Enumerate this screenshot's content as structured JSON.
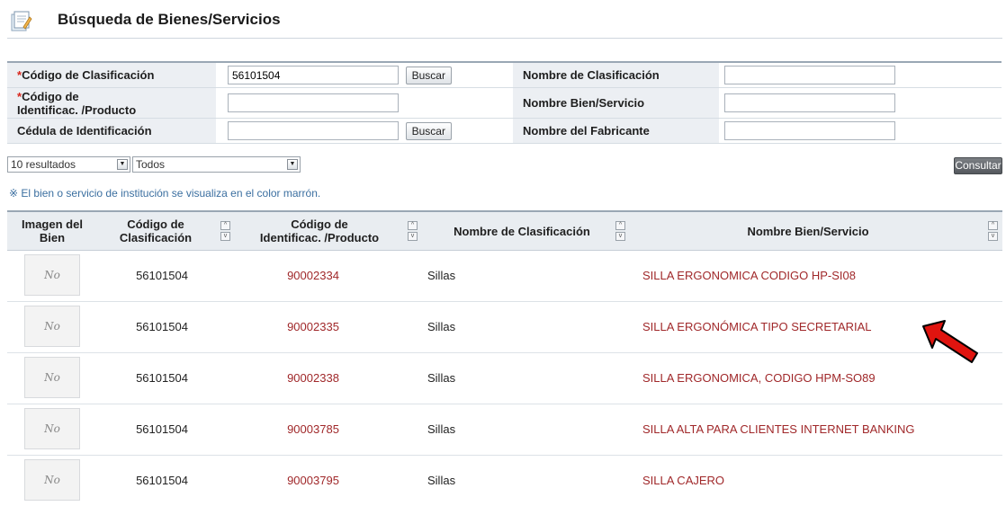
{
  "page": {
    "title": "Búsqueda de Bienes/Servicios"
  },
  "form": {
    "codigo_clasificacion": {
      "label": "Código de Clasificación",
      "value": "56101504",
      "button": "Buscar"
    },
    "codigo_identificacion": {
      "label_line1": "Código de",
      "label_line2": "Identificac. /Producto",
      "value": ""
    },
    "cedula": {
      "label": "Cédula de Identificación",
      "value": "",
      "button": "Buscar"
    },
    "nombre_clasificacion": {
      "label": "Nombre de Clasificación",
      "value": ""
    },
    "nombre_bien": {
      "label": "Nombre Bien/Servicio",
      "value": ""
    },
    "nombre_fabricante": {
      "label": "Nombre del Fabricante",
      "value": ""
    },
    "required_mark": "*"
  },
  "controls": {
    "results_per_page": "10 resultados",
    "filter": "Todos",
    "consultar": "Consultar",
    "dropdown_glyph": "▼"
  },
  "note": "※ El bien o servicio de institución se visualiza en el color marrón.",
  "table": {
    "headers": {
      "imagen_line1": "Imagen del",
      "imagen_line2": "Bien",
      "clasificacion_line1": "Código de",
      "clasificacion_line2": "Clasificación",
      "identificacion_line1": "Código de",
      "identificacion_line2": "Identificac. /Producto",
      "nombre_clasificacion": "Nombre de Clasificación",
      "nombre_bien": "Nombre Bien/Servicio"
    },
    "sort_up": "^",
    "sort_down": "v",
    "no_image": "No",
    "rows": [
      {
        "clasificacion": "56101504",
        "identificacion": "90002334",
        "nombre_clasificacion": "Sillas",
        "nombre_bien": "SILLA ERGONOMICA CODIGO HP-SI08"
      },
      {
        "clasificacion": "56101504",
        "identificacion": "90002335",
        "nombre_clasificacion": "Sillas",
        "nombre_bien": "SILLA ERGONÓMICA TIPO SECRETARIAL"
      },
      {
        "clasificacion": "56101504",
        "identificacion": "90002338",
        "nombre_clasificacion": "Sillas",
        "nombre_bien": "SILLA ERGONOMICA, CODIGO HPM-SO89"
      },
      {
        "clasificacion": "56101504",
        "identificacion": "90003785",
        "nombre_clasificacion": "Sillas",
        "nombre_bien": "SILLA ALTA PARA CLIENTES INTERNET BANKING"
      },
      {
        "clasificacion": "56101504",
        "identificacion": "90003795",
        "nombre_clasificacion": "Sillas",
        "nombre_bien": "SILLA CAJERO"
      }
    ]
  },
  "colors": {
    "brown_link": "#a0282a",
    "note_blue": "#3b6fa0",
    "arrow_red": "#e0140f"
  },
  "icons": {
    "title": "notepad-icon",
    "annotation": "red-arrow-icon"
  }
}
